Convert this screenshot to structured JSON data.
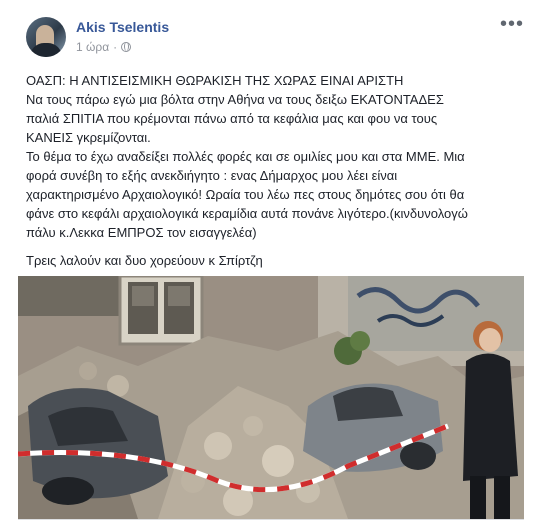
{
  "post": {
    "author": "Akis Tselentis",
    "timestamp": "1 ώρα",
    "privacy_icon": "globe-icon",
    "more_icon": "more-options-icon",
    "more_glyph": "•••",
    "text_lines": [
      "ΟΑΣΠ: Η ΑΝΤΙΣΕΙΣΜΙΚΗ ΘΩΡΑΚΙΣΗ ΤΗΣ ΧΩΡΑΣ ΕΙΝΑΙ ΑΡΙΣΤΗ",
      "Να τους πάρω εγώ μια βόλτα στην Αθήνα να τους δειξω ΕΚΑΤΟΝΤΑΔΕΣ",
      "παλιά ΣΠΙΤΙΑ που κρέμονται πάνω από τα κεφάλια μας και φου να τους",
      "ΚΑΝΕΙΣ γκρεμίζονται.",
      "Το θέμα το έχω αναδείξει πολλές φορές και σε ομιλίες μου και στα ΜΜΕ. Μια",
      "φορά συνέβη το εξής ανεκδιήγητο : ενας Δήμαρχος μου λέει είναι",
      "χαρακτηρισμένο Αρχαιολογικό! Ωραία του λέω πες στους δημότες σου ότι θα",
      "φάνε στο κεφάλι αρχαιολογικά κεραμίδια αυτά πονάνε λιγότερο.(κινδυνολογώ",
      "πάλυ κ.Λεκκα ΕΜΠΡΟΣ τον εισαγγελέα)"
    ],
    "closing_line": "Τρεις λαλούν και δυο χορεύουν κ Σπίρτζη"
  }
}
